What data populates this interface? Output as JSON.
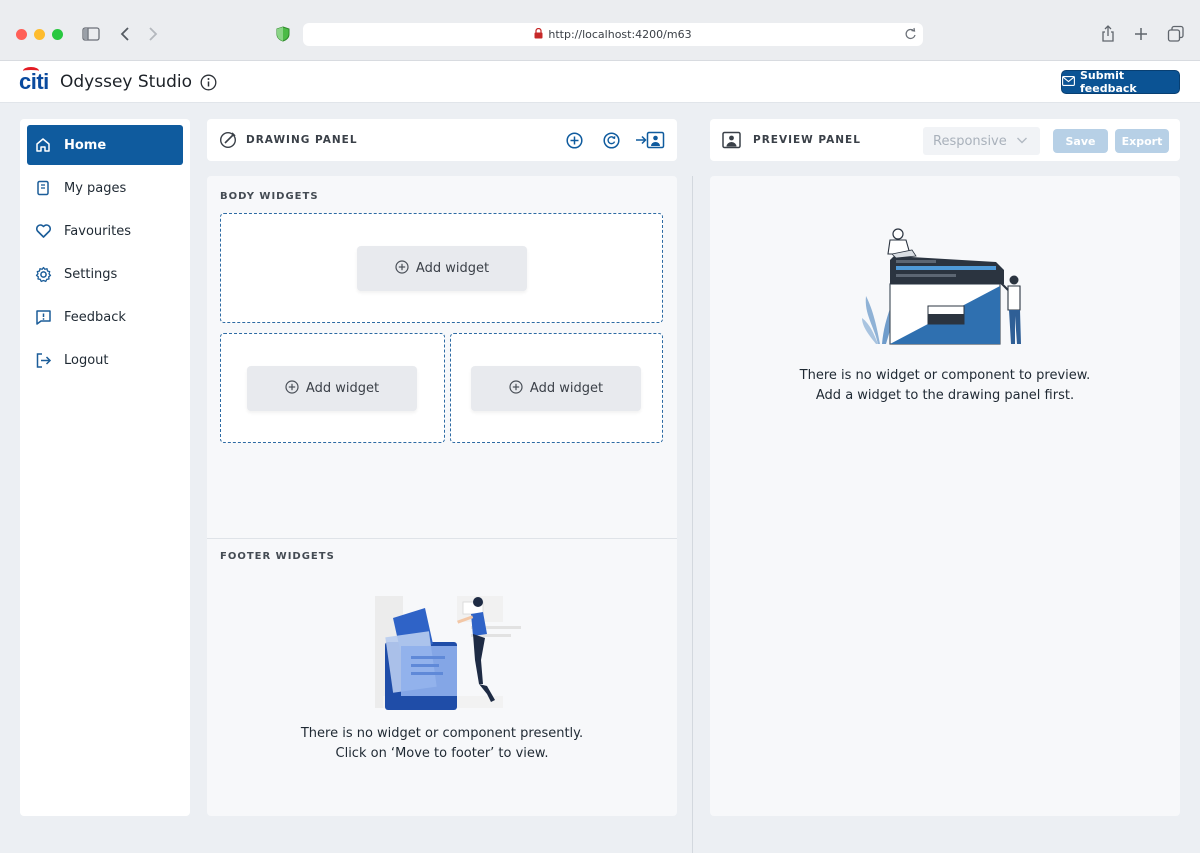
{
  "browser": {
    "url": "http://localhost:4200/m63"
  },
  "app": {
    "logo_text": "citi",
    "title": "Odyssey Studio",
    "submit_feedback_label": "Submit feedback"
  },
  "sidebar": {
    "items": [
      {
        "label": "Home",
        "icon": "home-icon",
        "active": true
      },
      {
        "label": "My pages",
        "icon": "pages-icon",
        "active": false
      },
      {
        "label": "Favourites",
        "icon": "heart-icon",
        "active": false
      },
      {
        "label": "Settings",
        "icon": "gear-icon",
        "active": false
      },
      {
        "label": "Feedback",
        "icon": "feedback-icon",
        "active": false
      },
      {
        "label": "Logout",
        "icon": "logout-icon",
        "active": false
      }
    ]
  },
  "drawing_panel": {
    "title": "DRAWING PANEL",
    "body_label": "BODY WIDGETS",
    "add_widget_label": "Add widget",
    "footer_label": "FOOTER WIDGETS",
    "footer_empty_line1": "There is no widget or component presently.",
    "footer_empty_line2": "Click on ‘Move to footer’ to view."
  },
  "preview_panel": {
    "title": "PREVIEW PANEL",
    "view_mode": "Responsive",
    "save_label": "Save",
    "export_label": "Export",
    "empty_line1": "There is no widget or component to preview.",
    "empty_line2": "Add a widget to the drawing panel first."
  },
  "colors": {
    "brand": "#0f5b9e",
    "accent_red": "#e31b23",
    "dashed_border": "#2d6aa3",
    "disabled_button": "#b7d0e6"
  }
}
